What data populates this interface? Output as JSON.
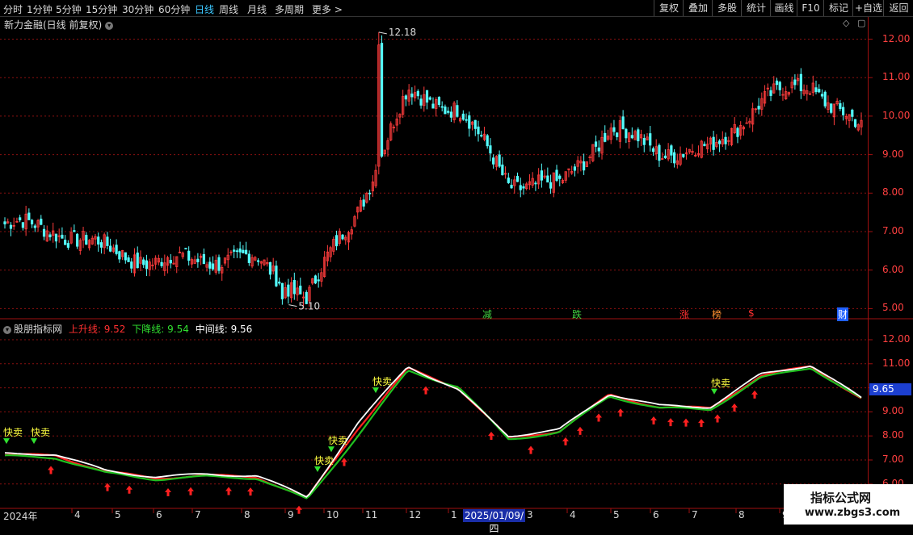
{
  "toolbar": {
    "periods": [
      "分时",
      "1分钟",
      "5分钟",
      "15分钟",
      "30分钟",
      "60分钟",
      "日线",
      "周线",
      "月线",
      "多周期",
      "更多 >"
    ],
    "active_period": "日线",
    "right_buttons": [
      "复权",
      "叠加",
      "多股",
      "统计",
      "画线",
      "F10",
      "标记",
      "+自选",
      "返回"
    ]
  },
  "stock_title": "新力金融(日线 前复权)",
  "indicator": {
    "name": "股朋指标网",
    "line_up_label": "上升线:",
    "line_up_value": "9.52",
    "line_down_label": "下降线:",
    "line_down_value": "9.54",
    "line_mid_label": "中间线:",
    "line_mid_value": "9.56",
    "current_price_tag": "9.65",
    "sell_signal_label": "快卖"
  },
  "price_axis": [
    "12.00",
    "11.00",
    "10.00",
    "9.00",
    "8.00",
    "7.00",
    "6.00",
    "5.00"
  ],
  "indicator_axis": [
    "12.00",
    "11.00",
    "10.00",
    "9.00",
    "8.00",
    "7.00",
    "6.00"
  ],
  "annotations": {
    "high": "12.18",
    "low": "5.10"
  },
  "events": [
    {
      "label": "减",
      "color": "#40d040"
    },
    {
      "label": "跌",
      "color": "#40d040"
    },
    {
      "label": "涨",
      "color": "#ff3030"
    },
    {
      "label": "榜",
      "color": "#ff9030"
    },
    {
      "label": "$",
      "color": "#ff3030"
    },
    {
      "label": "财",
      "color": "#ffffff",
      "bg": "#2060ff"
    }
  ],
  "date_axis": [
    "2024年",
    "4",
    "5",
    "6",
    "7",
    "8",
    "9",
    "10",
    "11",
    "12",
    "1",
    "3",
    "4",
    "5",
    "6",
    "7",
    "8",
    "9"
  ],
  "date_highlight": "2025/01/09/四",
  "watermark": {
    "line1": "指标公式网",
    "line2": "www.zbgs3.com"
  },
  "colors": {
    "up": "#ff3c3c",
    "down": "#54ffff",
    "line_up": "#ff2020",
    "line_down": "#20c020",
    "line_mid": "#ffffff",
    "grid": "#8a1010"
  },
  "chart_data": {
    "type": "candlestick",
    "title": "新力金融(日线 前复权)",
    "ylim": [
      4.8,
      12.35
    ],
    "high": 12.18,
    "low": 5.1,
    "x": [
      "2024-03",
      "2024-04",
      "2024-05",
      "2024-06",
      "2024-07",
      "2024-08",
      "2024-09",
      "2024-10",
      "2024-11",
      "2024-12",
      "2025-01",
      "2025-03",
      "2025-04",
      "2025-05",
      "2025-06",
      "2025-07",
      "2025-08",
      "2025-09"
    ],
    "close": [
      7.2,
      7.05,
      6.55,
      6.2,
      6.3,
      6.25,
      5.3,
      7.6,
      10.6,
      10.2,
      8.3,
      8.15,
      9.7,
      9.1,
      9.1,
      10.4,
      10.85,
      9.6
    ],
    "indicator": {
      "ylim": [
        5.5,
        12.6
      ],
      "series": [
        {
          "name": "上升线",
          "values": [
            7.2,
            7.2,
            6.5,
            6.25,
            6.35,
            6.3,
            5.4,
            8.3,
            10.8,
            10.0,
            7.9,
            8.2,
            9.7,
            9.2,
            9.15,
            10.5,
            10.9,
            9.55
          ]
        },
        {
          "name": "下降线",
          "values": [
            7.15,
            7.1,
            6.45,
            6.2,
            6.3,
            6.25,
            5.35,
            8.0,
            10.7,
            10.05,
            7.85,
            8.15,
            9.65,
            9.15,
            9.1,
            10.4,
            10.85,
            9.54
          ]
        },
        {
          "name": "中间线",
          "values": [
            7.25,
            7.25,
            6.55,
            6.3,
            6.4,
            6.35,
            5.45,
            8.5,
            10.9,
            9.9,
            8.0,
            8.25,
            9.75,
            9.25,
            9.2,
            10.55,
            10.95,
            9.56
          ]
        }
      ]
    }
  }
}
